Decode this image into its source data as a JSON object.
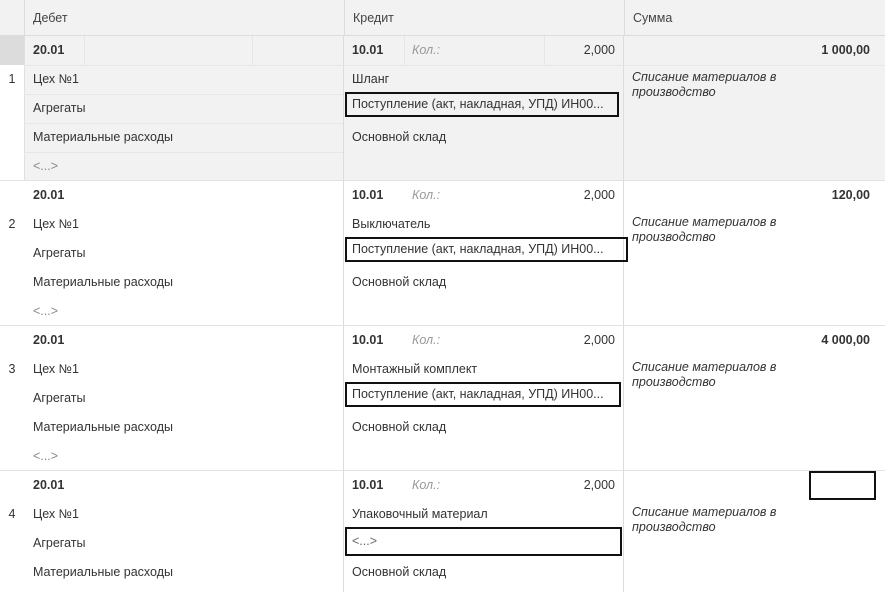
{
  "header": {
    "debit": "Дебет",
    "credit": "Кредит",
    "sum": "Сумма"
  },
  "kol_label": "Кол.:",
  "entries": [
    {
      "num": "1",
      "debit_account": "20.01",
      "debit_sub1": "Цех №1",
      "debit_sub2": "Агрегаты",
      "debit_sub3": "Материальные расходы",
      "debit_sub4": "<...>",
      "credit_account": "10.01",
      "qty": "2,000",
      "credit_sub1": "Шланг",
      "credit_sub2": "Поступление (акт, накладная, УПД) ИН00...",
      "credit_sub3": "Основной склад",
      "sum": "1 000,00",
      "description": "Списание материалов в производство",
      "selected": true
    },
    {
      "num": "2",
      "debit_account": "20.01",
      "debit_sub1": "Цех №1",
      "debit_sub2": "Агрегаты",
      "debit_sub3": "Материальные расходы",
      "debit_sub4": "<...>",
      "credit_account": "10.01",
      "qty": "2,000",
      "credit_sub1": "Выключатель",
      "credit_sub2": "Поступление (акт, накладная, УПД) ИН00...",
      "credit_sub3": "Основной склад",
      "sum": "120,00",
      "description": "Списание материалов в производство"
    },
    {
      "num": "3",
      "debit_account": "20.01",
      "debit_sub1": "Цех №1",
      "debit_sub2": "Агрегаты",
      "debit_sub3": "Материальные расходы",
      "debit_sub4": "<...>",
      "credit_account": "10.01",
      "qty": "2,000",
      "credit_sub1": "Монтажный комплект",
      "credit_sub2": "Поступление (акт, накладная, УПД) ИН00...",
      "credit_sub3": "Основной склад",
      "sum": "4 000,00",
      "description": "Списание материалов в производство"
    },
    {
      "num": "4",
      "debit_account": "20.01",
      "debit_sub1": "Цех №1",
      "debit_sub2": "Агрегаты",
      "debit_sub3": "Материальные расходы",
      "credit_account": "10.01",
      "qty": "2,000",
      "credit_sub1": "Упаковочный материал",
      "credit_sub2": "<...>",
      "credit_sub3": "Основной склад",
      "sum": "",
      "description": "Списание материалов в производство"
    }
  ]
}
